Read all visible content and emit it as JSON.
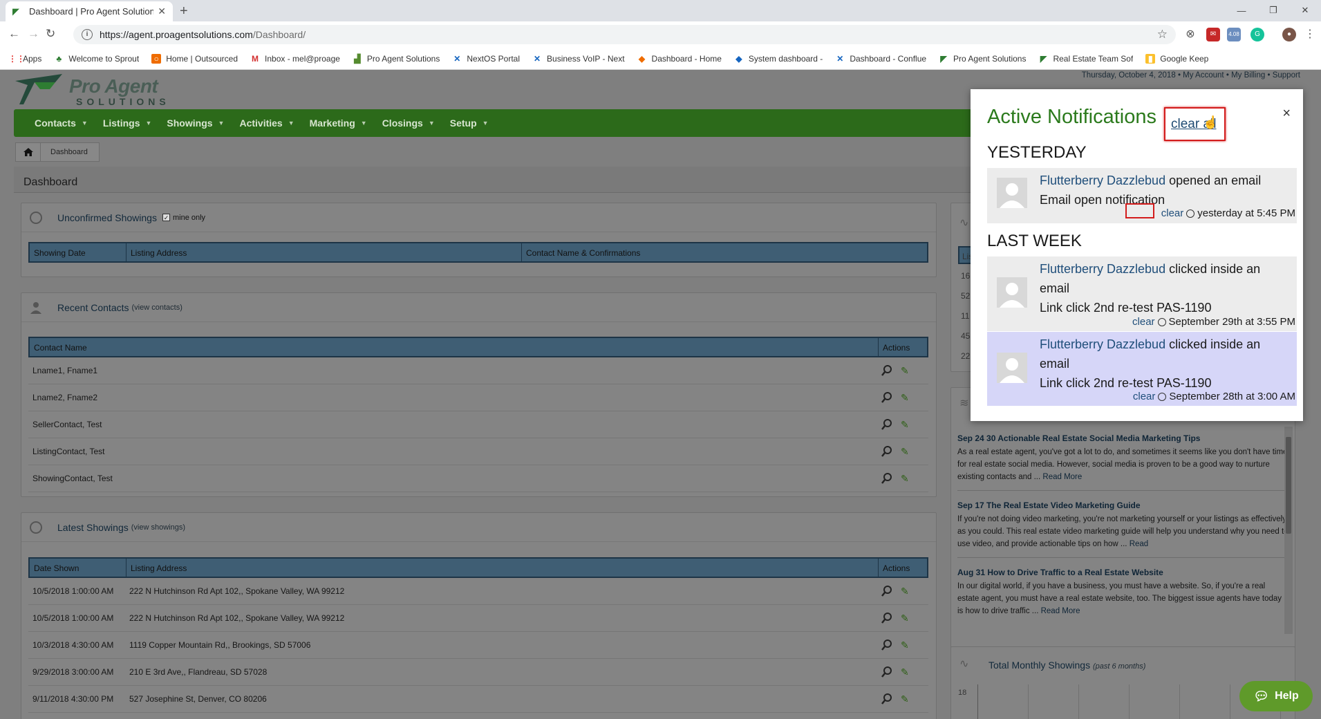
{
  "browser": {
    "tab_title": "Dashboard | Pro Agent Solutions",
    "url_host": "https://agent.proagentsolutions.com",
    "url_path": "/Dashboard/",
    "ext_badge": "4.08",
    "bookmarks": [
      "Apps",
      "Welcome to Sprout",
      "Home | Outsourced",
      "Inbox - mel@proage",
      "Pro Agent Solutions",
      "NextOS Portal",
      "Business VoIP - Next",
      "Dashboard - Home",
      "System dashboard -",
      "Dashboard - Conflue",
      "Pro Agent Solutions",
      "Real Estate Team Sof",
      "Google Keep"
    ]
  },
  "header": {
    "logo_line1": "Pro Agent",
    "logo_line2": "SOLUTIONS",
    "date_text": "Thursday, October 4, 2018",
    "my_account": "My Account",
    "my_billing": "My Billing",
    "support": "Support",
    "sep": "•"
  },
  "nav": [
    "Contacts",
    "Listings",
    "Showings",
    "Activities",
    "Marketing",
    "Closings",
    "Setup"
  ],
  "breadcrumb": "Dashboard",
  "page_title": "Dashboard",
  "unconfirmed": {
    "title": "Unconfirmed Showings",
    "mine_only": "mine only",
    "cols": [
      "Showing Date",
      "Listing Address",
      "Contact Name & Confirmations"
    ]
  },
  "recent_contacts": {
    "title": "Recent Contacts",
    "sub": "(view contacts)",
    "cols": [
      "Contact Name",
      "Actions"
    ],
    "rows": [
      "Lname1, Fname1",
      "Lname2, Fname2",
      "SellerContact, Test",
      "ListingContact, Test",
      "ShowingContact, Test"
    ]
  },
  "latest_showings": {
    "title": "Latest Showings",
    "sub": "(view showings)",
    "cols": [
      "Date Shown",
      "Listing Address",
      "Actions"
    ],
    "rows": [
      {
        "date": "10/5/2018 1:00:00 AM",
        "addr": "222 N Hutchinson Rd Apt 102,, Spokane Valley, WA 99212"
      },
      {
        "date": "10/5/2018 1:00:00 AM",
        "addr": "222 N Hutchinson Rd Apt 102,, Spokane Valley, WA 99212"
      },
      {
        "date": "10/3/2018 4:30:00 AM",
        "addr": "1119 Copper Mountain Rd,, Brookings, SD 57006"
      },
      {
        "date": "9/29/2018 3:00:00 AM",
        "addr": "210 E 3rd Ave,, Flandreau, SD 57028"
      },
      {
        "date": "9/11/2018 4:30:00 PM",
        "addr": "527 Josephine St, Denver, CO 80206"
      }
    ]
  },
  "right_table": {
    "head": "Lis",
    "rows": [
      "16",
      "52",
      "11",
      "45",
      "22"
    ]
  },
  "blog": [
    {
      "title": "Sep 24 30 Actionable Real Estate Social Media Marketing Tips",
      "body": "As a real estate agent, you've got a lot to do, and sometimes it seems like you don't have time for real estate social media. However, social media is proven to be a good way to nurture existing contacts and ...",
      "more": "Read More"
    },
    {
      "title": "Sep 17 The Real Estate Video Marketing Guide",
      "body": "If you're not doing video marketing, you're not marketing yourself or your listings as effectively as you could. This real estate video marketing guide will help you understand why you need to use video, and provide actionable tips on how ...",
      "more": "Read"
    },
    {
      "title": "Aug 31 How to Drive Traffic to a Real Estate Website",
      "body": "In our digital world, if you have a business, you must have a website. So, if you're a real estate agent, you must have a real estate website, too. The biggest issue agents have today is how to drive traffic ...",
      "more": "Read More"
    }
  ],
  "monthly": {
    "title": "Total Monthly Showings",
    "sub": "(past 6 months)",
    "y_tick": "18"
  },
  "help_label": "Help",
  "notifications": {
    "title": "Active Notifications",
    "clear_all": "clear all",
    "close": "×",
    "sections": [
      {
        "label": "YESTERDAY",
        "items": [
          {
            "who": "Flutterberry Dazzlebud",
            "action": "opened an email",
            "detail": "Email open notification",
            "clear": "clear",
            "when": "yesterday at 5:45 PM"
          }
        ]
      },
      {
        "label": "LAST WEEK",
        "items": [
          {
            "who": "Flutterberry Dazzlebud",
            "action": "clicked inside an email",
            "detail": "Link click 2nd re-test PAS-1190",
            "clear": "clear",
            "when": "September 29th at 3:55 PM"
          },
          {
            "who": "Flutterberry Dazzlebud",
            "action": "clicked inside an email",
            "detail": "Link click 2nd re-test PAS-1190",
            "clear": "clear",
            "when": "September 28th at 3:00 AM"
          }
        ]
      }
    ]
  }
}
